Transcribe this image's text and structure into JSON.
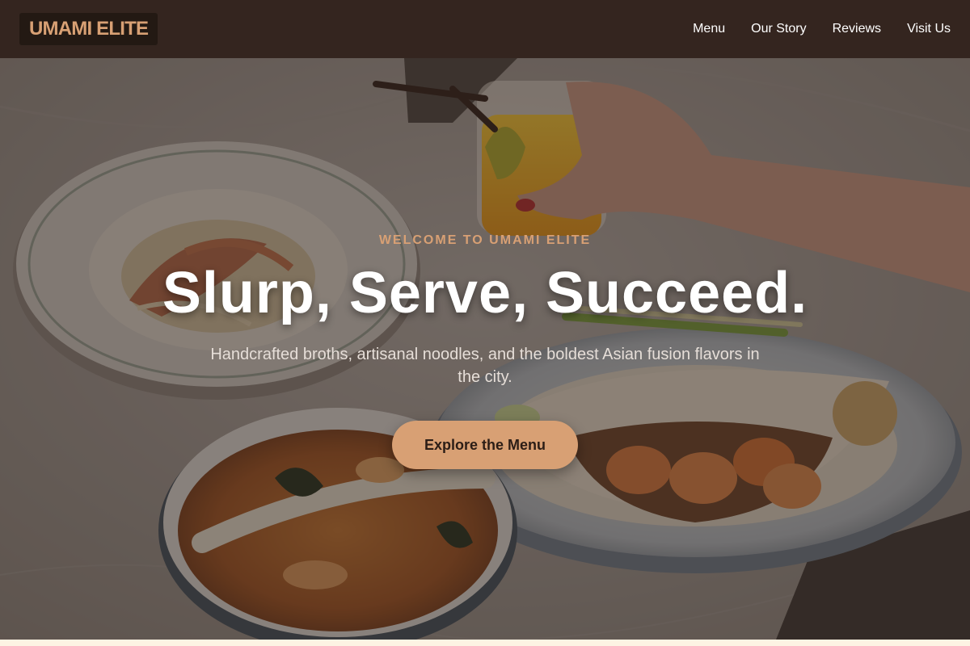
{
  "header": {
    "logo": "UMAMI ELITE",
    "nav": [
      {
        "label": "Menu"
      },
      {
        "label": "Our Story"
      },
      {
        "label": "Reviews"
      },
      {
        "label": "Visit Us"
      }
    ]
  },
  "hero": {
    "eyebrow": "WELCOME TO UMAMI ELITE",
    "headline": "Slurp, Serve, Succeed.",
    "subhead": "Handcrafted broths, artisanal noodles, and the boldest Asian fusion flavors in the city.",
    "cta_label": "Explore the Menu"
  },
  "colors": {
    "header_bg": "#34251f",
    "accent": "#d8a074",
    "page_bg": "#fdf3e3"
  }
}
